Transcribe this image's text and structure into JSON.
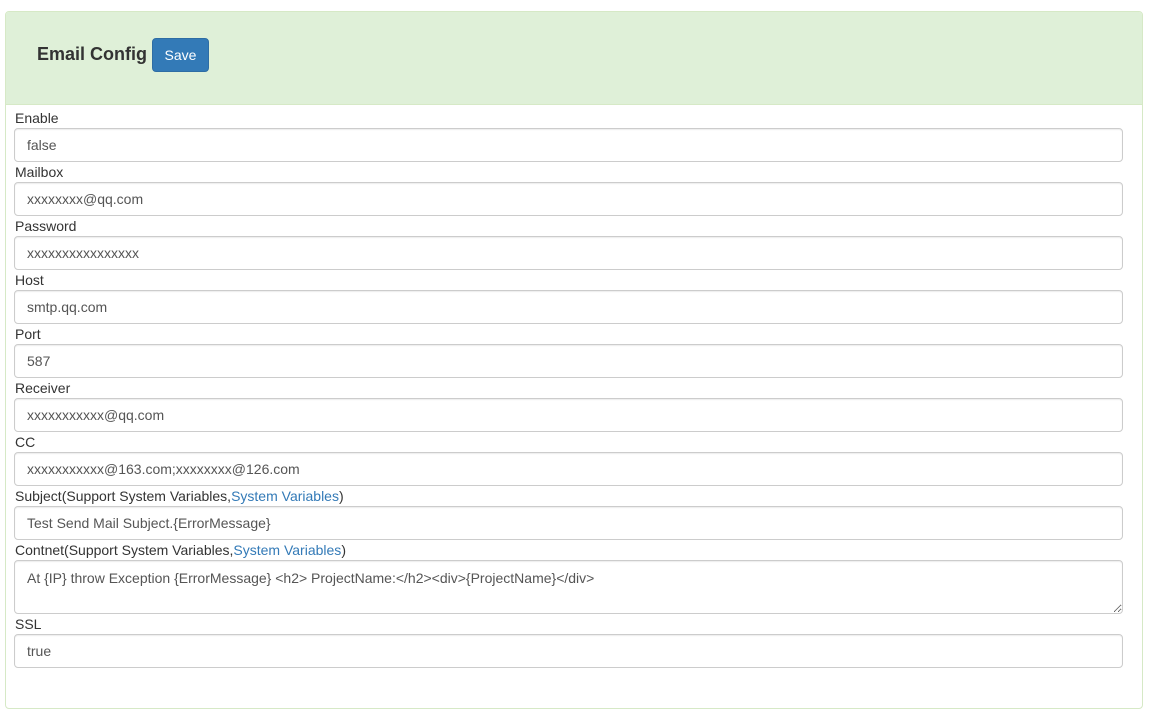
{
  "header": {
    "title": "Email Config",
    "save_label": "Save",
    "background": "#dff0d8",
    "accent": "#337ab7"
  },
  "fields": {
    "enable": {
      "label": "Enable",
      "value": "false"
    },
    "mailbox": {
      "label": "Mailbox",
      "value": "xxxxxxxx@qq.com"
    },
    "password": {
      "label": "Password",
      "value": "xxxxxxxxxxxxxxxx"
    },
    "host": {
      "label": "Host",
      "value": "smtp.qq.com"
    },
    "port": {
      "label": "Port",
      "value": "587"
    },
    "receiver": {
      "label": "Receiver",
      "value": "xxxxxxxxxxx@qq.com"
    },
    "cc": {
      "label": "CC",
      "value": "xxxxxxxxxxx@163.com;xxxxxxxx@126.com"
    },
    "subject": {
      "label_prefix": "Subject(Support System Variables,",
      "label_link": "System Variables",
      "label_suffix": ")",
      "value": "Test Send Mail Subject.{ErrorMessage}"
    },
    "content": {
      "label_prefix": "Contnet(Support System Variables,",
      "label_link": "System Variables",
      "label_suffix": ")",
      "value": "At {IP} throw Exception {ErrorMessage} <h2> ProjectName:</h2><div>{ProjectName}</div>"
    },
    "ssl": {
      "label": "SSL",
      "value": "true"
    }
  }
}
